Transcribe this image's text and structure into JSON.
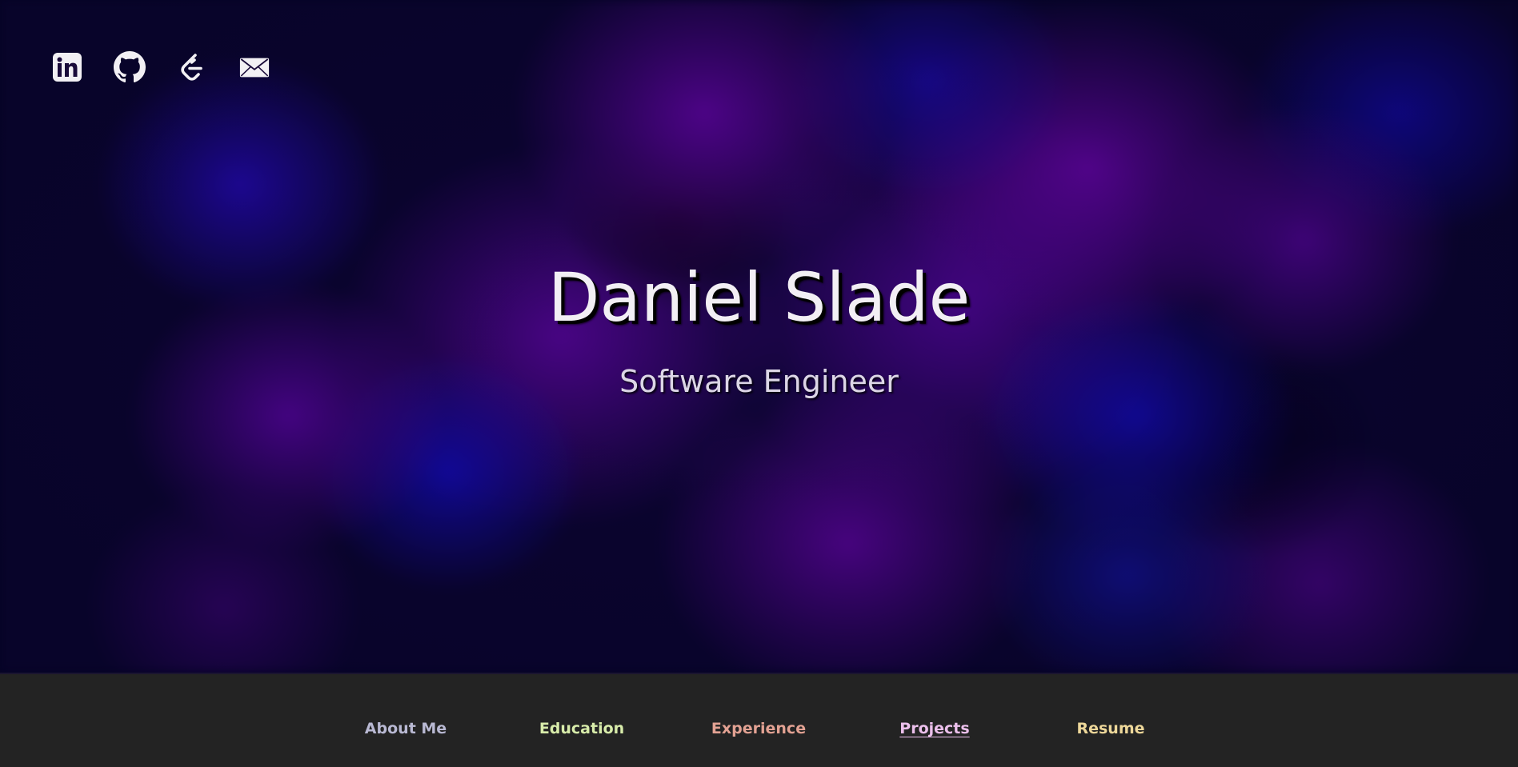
{
  "header": {
    "name": "Daniel Slade",
    "subtitle": "Software Engineer"
  },
  "socials": [
    {
      "icon": "linkedin-icon",
      "label": "LinkedIn"
    },
    {
      "icon": "github-icon",
      "label": "GitHub"
    },
    {
      "icon": "leetcode-icon",
      "label": "LeetCode"
    },
    {
      "icon": "mail-icon",
      "label": "Email"
    }
  ],
  "nav": {
    "items": [
      {
        "label": "About Me",
        "color": "#b9b9d3"
      },
      {
        "label": "Education",
        "color": "#d8ecaa"
      },
      {
        "label": "Experience",
        "color": "#e3a293"
      },
      {
        "label": "Projects",
        "color": "#ecc0ec",
        "active": true
      },
      {
        "label": "Resume",
        "color": "#eed89a"
      }
    ]
  },
  "colors": {
    "background": "#0b0530",
    "navbar": "#232323",
    "title": "#f2eff4"
  }
}
